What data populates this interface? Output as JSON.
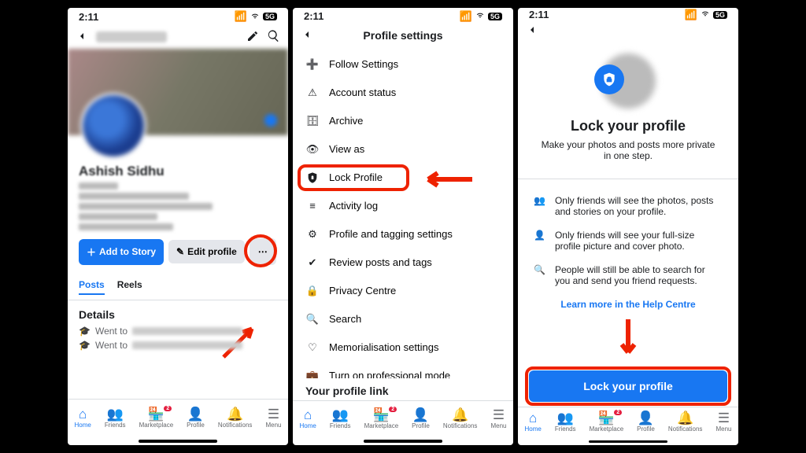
{
  "status_time": "2:11",
  "status_net": "5G",
  "screen1": {
    "profile_name": "Ashish Sidhu",
    "add_story": "Add to Story",
    "edit_profile": "Edit profile",
    "tab_posts": "Posts",
    "tab_reels": "Reels",
    "details_head": "Details",
    "went_to": "Went to"
  },
  "screen2": {
    "title": "Profile settings",
    "items": [
      "Follow Settings",
      "Account status",
      "Archive",
      "View as",
      "Lock Profile",
      "Activity log",
      "Profile and tagging settings",
      "Review posts and tags",
      "Privacy Centre",
      "Search",
      "Memorialisation settings",
      "Turn on professional mode"
    ],
    "link_head": "Your profile link"
  },
  "screen3": {
    "heading": "Lock your profile",
    "sub": "Make your photos and posts more private in one step.",
    "p1": "Only friends will see the photos, posts and stories on your profile.",
    "p2": "Only friends will see your full-size profile picture and cover photo.",
    "p3": "People will still be able to search for you and send you friend requests.",
    "learn_more": "Learn more in the Help Centre",
    "cta": "Lock your profile"
  },
  "nav": {
    "home": "Home",
    "friends": "Friends",
    "market": "Marketplace",
    "profile": "Profile",
    "notif": "Notifications",
    "menu": "Menu",
    "badge": "2"
  }
}
